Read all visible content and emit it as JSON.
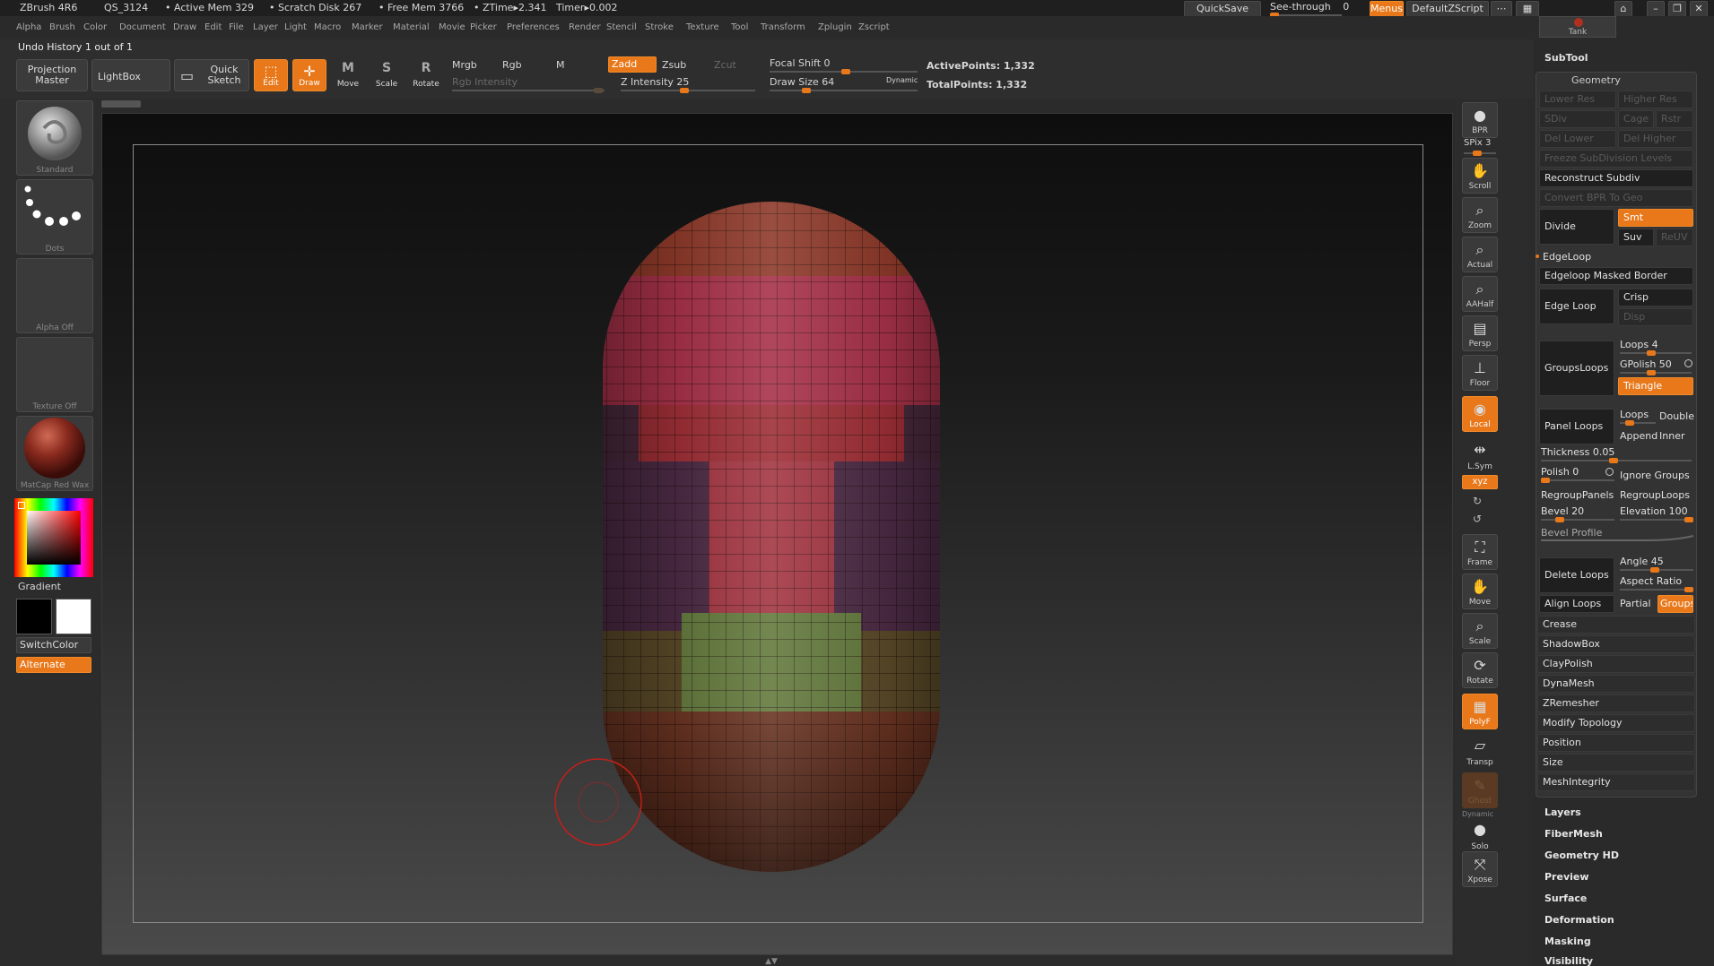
{
  "title_bar": {
    "app": "ZBrush 4R6",
    "doc": "QS_3124",
    "active_mem": "• Active Mem 329",
    "scratch": "• Scratch Disk 267",
    "free_mem": "• Free Mem 3766",
    "ztime": "• ZTime▸2.341",
    "timer": "Timer▸0.002",
    "quicksave": "QuickSave",
    "see_through": "See-through",
    "see_through_value": "0",
    "menus": "Menus",
    "default_zscript": "DefaultZScript"
  },
  "menu_bar": [
    "Alpha",
    "Brush",
    "Color",
    "Document",
    "Draw",
    "Edit",
    "File",
    "Layer",
    "Light",
    "Macro",
    "Marker",
    "Material",
    "Movie",
    "Picker",
    "Preferences",
    "Render",
    "Stencil",
    "Stroke",
    "Texture",
    "Tool",
    "Transform",
    "Zplugin",
    "Zscript"
  ],
  "undo_history": "Undo History 1 out of 1",
  "toolbar": {
    "projection_master": "Projection Master",
    "lightbox": "LightBox",
    "quick_sketch": "Quick Sketch",
    "edit": "Edit",
    "draw": "Draw",
    "move": "Move",
    "scale": "Scale",
    "rotate": "Rotate",
    "mrgb": "Mrgb",
    "rgb": "Rgb",
    "m": "M",
    "zadd": "Zadd",
    "zsub": "Zsub",
    "zcut": "Zcut",
    "rgb_intensity": "Rgb Intensity",
    "z_intensity": "Z Intensity 25",
    "focal_shift": "Focal Shift 0",
    "draw_size": "Draw Size 64",
    "dynamic": "Dynamic",
    "active_points": "ActivePoints: 1,332",
    "total_points": "TotalPoints: 1,332"
  },
  "left_shelf": {
    "brush": "Standard",
    "stroke": "Dots",
    "alpha": "Alpha Off",
    "texture": "Texture Off",
    "material": "MatCap Red Wax",
    "gradient": "Gradient",
    "switch_color": "SwitchColor",
    "alternate": "Alternate"
  },
  "right_shelf": {
    "bpr": "BPR",
    "spix": "SPix 3",
    "scroll": "Scroll",
    "zoom": "Zoom",
    "actual": "Actual",
    "aahalf": "AAHalf",
    "persp": "Persp",
    "floor": "Floor",
    "local": "Local",
    "lsym": "L.Sym",
    "xyz": "xyz",
    "frame": "Frame",
    "move": "Move",
    "scale": "Scale",
    "rotate": "Rotate",
    "polyf": "PolyF",
    "transp": "Transp",
    "ghost": "Ghost",
    "dynamic": "Dynamic",
    "solo": "Solo",
    "xpose": "Xpose"
  },
  "palette": {
    "tank": "Tank",
    "subtool": "SubTool",
    "geometry": "Geometry",
    "lower_res": "Lower Res",
    "higher_res": "Higher Res",
    "sdiv": "SDiv",
    "cage": "Cage",
    "rstr": "Rstr",
    "del_lower": "Del Lower",
    "del_higher": "Del Higher",
    "freeze": "Freeze SubDivision Levels",
    "reconstruct": "Reconstruct Subdiv",
    "convert_bpr": "Convert BPR To Geo",
    "divide": "Divide",
    "smt": "Smt",
    "suv": "Suv",
    "reuv": "ReUV",
    "edgeloop": "EdgeLoop",
    "edgeloop_masked": "Edgeloop Masked Border",
    "edge_loop": "Edge Loop",
    "crisp": "Crisp",
    "disp": "Disp",
    "groups_loops": "GroupsLoops",
    "loops4": "Loops 4",
    "gpolish": "GPolish 50",
    "triangle": "Triangle",
    "panel_loops": "Panel Loops",
    "loops": "Loops",
    "double": "Double",
    "append": "Append",
    "inner": "Inner",
    "thickness": "Thickness 0.05",
    "polish": "Polish 0",
    "ignore_groups": "Ignore Groups",
    "regroup_panels": "RegroupPanels",
    "regroup_loops": "RegroupLoops",
    "bevel": "Bevel 20",
    "elevation": "Elevation 100",
    "bevel_profile": "Bevel Profile",
    "delete_loops": "Delete Loops",
    "angle": "Angle 45",
    "aspect_ratio": "Aspect Ratio",
    "align_loops": "Align Loops",
    "partial": "Partial",
    "groups": "Groups",
    "crease": "Crease",
    "shadowbox": "ShadowBox",
    "claypolish": "ClayPolish",
    "dynamesh": "DynaMesh",
    "zremesher": "ZRemesher",
    "modify_topology": "Modify Topology",
    "position": "Position",
    "size": "Size",
    "mesh_integrity": "MeshIntegrity",
    "layers": "Layers",
    "fibermesh": "FiberMesh",
    "geometry_hd": "Geometry HD",
    "preview": "Preview",
    "surface": "Surface",
    "deformation": "Deformation",
    "masking": "Masking",
    "visibility": "Visibility"
  },
  "colors": {
    "accent": "#e8781a",
    "bg": "#2b2b2b"
  }
}
